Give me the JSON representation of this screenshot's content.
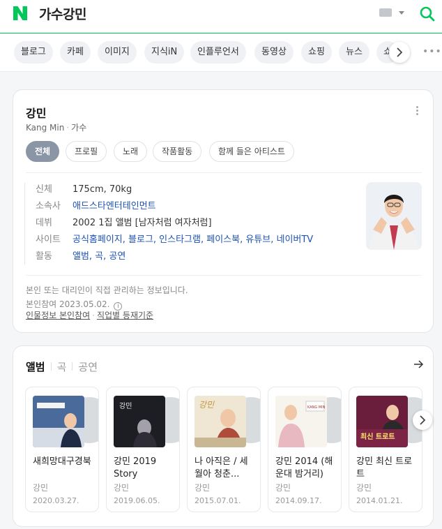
{
  "header": {
    "logo_letter": "N",
    "query": "가수강민"
  },
  "tabs": [
    "블로그",
    "카페",
    "이미지",
    "지식iN",
    "인플루언서",
    "동영상",
    "쇼핑",
    "뉴스",
    "쇼"
  ],
  "profile": {
    "name": "강민",
    "english_name": "Kang Min",
    "occupation": "가수",
    "chips": [
      "전체",
      "프로필",
      "노래",
      "작품활동",
      "함께 들은 아티스트"
    ],
    "info": [
      {
        "label": "신체",
        "value": "175cm, 70kg",
        "link": false
      },
      {
        "label": "소속사",
        "value": "애드스타엔터테인먼트",
        "link": true
      },
      {
        "label": "데뷔",
        "value": "2002 1집 앨범 [남자처럼 여자처럼]",
        "link": false
      },
      {
        "label": "사이트",
        "value": "공식홈페이지, 블로그, 인스타그램, 페이스북, 유튜브, 네이버TV",
        "link": true
      },
      {
        "label": "활동",
        "value": "앨범, 곡, 공연",
        "link": true
      }
    ],
    "note": "본인 또는 대리인이 직접 관리하는 정보입니다.",
    "verified": "본인참여 2023.05.02.",
    "info_icon": "i",
    "link1": "인물정보 본인참여",
    "link2": "직업별 등재기준"
  },
  "albums": {
    "tabs": [
      "앨범",
      "곡",
      "공연"
    ],
    "items": [
      {
        "title": "새희망대구경북",
        "artist": "강민",
        "date": "2020.03.27."
      },
      {
        "title": "강민 2019 Story",
        "artist": "강민",
        "date": "2019.06.05."
      },
      {
        "title": "나 아직은 / 세월아 청춘...",
        "artist": "강민",
        "date": "2015.07.01."
      },
      {
        "title": "강민 2014 (해운대 밤거리)",
        "artist": "강민",
        "date": "2014.09.17."
      },
      {
        "title": "강민 최신 트로트",
        "artist": "강민",
        "date": "2014.01.21."
      }
    ],
    "cover_text": [
      "강민",
      "강민",
      "강민",
      "KANG MIN",
      "최신 트로트"
    ]
  },
  "colors": {
    "brand_green": "#03c75a",
    "link_blue": "#1d52b8",
    "chip_active": "#8a95a5"
  }
}
